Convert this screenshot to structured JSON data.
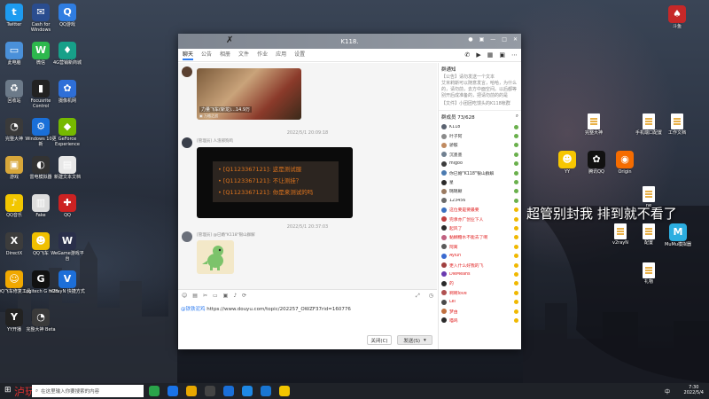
{
  "desktop": {
    "overlay_text": "超管别封我 排到就不看了",
    "icons_left": [
      {
        "label": "Twitter",
        "icon": "twitter-icon",
        "color": "#1d9bf0",
        "glyph": "t"
      },
      {
        "label": "Cash for Windows",
        "icon": "cash-icon",
        "color": "#2a4d8f",
        "glyph": "✉"
      },
      {
        "label": "QQ游戏",
        "icon": "qq-game-icon",
        "color": "#2f7de1",
        "glyph": "Q"
      },
      {
        "label": "此电脑",
        "icon": "computer-icon",
        "color": "#4a90d9",
        "glyph": "▭"
      },
      {
        "label": "微信",
        "icon": "wechat-icon",
        "color": "#2db84d",
        "glyph": "W"
      },
      {
        "label": "4G营销新商城",
        "icon": "mall-icon",
        "color": "#17a089",
        "glyph": "♦"
      },
      {
        "label": "回收站",
        "icon": "recycle-bin-icon",
        "color": "#6c7a89",
        "glyph": "♻"
      },
      {
        "label": "Focusrite Control",
        "icon": "focusrite-icon",
        "color": "#222",
        "glyph": "▮"
      },
      {
        "label": "摄像机网",
        "icon": "camera-net-icon",
        "color": "#2e6fd8",
        "glyph": "✿"
      },
      {
        "label": "完整大神",
        "icon": "speed-icon",
        "color": "#3a3a3a",
        "glyph": "◔"
      },
      {
        "label": "Windows 10更新",
        "icon": "update-icon",
        "color": "#1a6fd8",
        "glyph": "⚙"
      },
      {
        "label": "GeForce Experience",
        "icon": "geforce-icon",
        "color": "#76b900",
        "glyph": "◆"
      },
      {
        "label": "游戏",
        "icon": "game-folder-icon",
        "color": "#d8a73a",
        "glyph": "▣"
      },
      {
        "label": "雷电模拟器",
        "icon": "emulator-icon",
        "color": "#333",
        "glyph": "◐"
      },
      {
        "label": "新建文本文档",
        "icon": "text-doc-icon",
        "color": "#e8e8e8",
        "glyph": "▤"
      },
      {
        "label": "QQ音乐",
        "icon": "qq-music-icon",
        "color": "#f2c600",
        "glyph": "♪"
      },
      {
        "label": "Fake",
        "icon": "fake-icon",
        "color": "#ddd",
        "glyph": "▥"
      },
      {
        "label": "QQ",
        "icon": "qq-icon",
        "color": "#c22",
        "glyph": "✚"
      },
      {
        "label": "DirectX",
        "icon": "directx-icon",
        "color": "#3c3c3c",
        "glyph": "X"
      },
      {
        "label": "QQ飞车",
        "icon": "qq-speed-icon",
        "color": "#f0c000",
        "glyph": "☻"
      },
      {
        "label": "WeGame游戏平台",
        "icon": "wegame-icon",
        "color": "#2a2f4a",
        "glyph": "W"
      },
      {
        "label": "QQ飞车修复工具",
        "icon": "repair-icon",
        "color": "#f0a800",
        "glyph": "☺"
      },
      {
        "label": "Logitech G HUB",
        "icon": "logitech-icon",
        "color": "#111",
        "glyph": "G"
      },
      {
        "label": "v2rayN 快捷方式",
        "icon": "v2ray-icon",
        "color": "#1d6fd8",
        "glyph": "V"
      },
      {
        "label": "YY开播",
        "icon": "yy-icon",
        "color": "#222",
        "glyph": "Y"
      },
      {
        "label": "完整大神 Beta",
        "icon": "speed-beta-icon",
        "color": "#3a3a3a",
        "glyph": "◔"
      }
    ],
    "icons_right": [
      {
        "label": "斗鱼",
        "icon": "douyu-icon",
        "color": "#c62828",
        "glyph": "♠"
      },
      {
        "label": "完整大神",
        "icon": "file-icon"
      },
      {
        "label": "手机端口配置",
        "icon": "file-icon"
      },
      {
        "label": "工作文档",
        "icon": "file-icon"
      },
      {
        "label": "YY",
        "icon": "yy-face-icon",
        "color": "#f7c600",
        "glyph": "☻"
      },
      {
        "label": "腾讯QQ",
        "icon": "tencent-qq-icon",
        "color": "#111",
        "glyph": "✿"
      },
      {
        "label": "Origin",
        "icon": "origin-icon",
        "color": "#f56c00",
        "glyph": "◉"
      },
      {
        "label": "ne",
        "icon": "file-icon"
      },
      {
        "label": "v2rayN",
        "icon": "file-icon"
      },
      {
        "label": "配置",
        "icon": "file-icon"
      },
      {
        "label": "MuMu模拟器",
        "icon": "mumu-icon",
        "color": "#2caee0",
        "glyph": "M"
      },
      {
        "label": "礼物",
        "icon": "file-icon"
      }
    ]
  },
  "window": {
    "title": "K118.",
    "controls": [
      "●",
      "▣",
      "—",
      "□",
      "✕"
    ],
    "tabs": [
      "聊天",
      "公告",
      "相册",
      "文件",
      "作业",
      "应用",
      "设置"
    ],
    "active_tab": "聊天",
    "tool_icons": [
      "phone-icon",
      "video-icon",
      "screen-share-icon",
      "apps-icon",
      "more-icon"
    ],
    "tool_glyphs": [
      "✆",
      "▶",
      "▦",
      "▣",
      "⋯"
    ]
  },
  "chat": {
    "image_caption": "力量飞车(斩龙)…14.9万",
    "image_sub": "▣ 万格之战",
    "timestamp_1": "2022/5/1 20:09:18",
    "sender_2": "[管理员] 人渣邪狗鸡",
    "card_lines": [
      "• [Q1123367121]: 这是测试服",
      "• [Q1123367121]: 不让测挂？",
      "• [Q1123367121]: 你是来测试的吗"
    ],
    "timestamp_2": "2022/5/1 20:37:03",
    "sender_3": "[管理员] @已婚\"K118\"银山群解",
    "toolbar_icons": [
      "emoji-icon",
      "gif-icon",
      "scissors-icon",
      "folder-icon",
      "image-icon",
      "audio-icon",
      "history-icon"
    ],
    "toolbar_glyphs": [
      "☺",
      "▤",
      "✂",
      "▭",
      "▣",
      "♪",
      "⟳"
    ],
    "input_mention": "@铁铁泥鸡",
    "input_text": "https://www.douyu.com/topic/202257_OWZF37rid=160776",
    "close_label": "关闭(C)",
    "send_label": "发送(S)"
  },
  "sidebar": {
    "notice_title": "群通知",
    "notice_lines": [
      "【公告】请勿发送一个文本",
      "艾米莉斯可以随意发言，哈哈，为什么",
      "的，请勿前，去方中面空间。以后都等",
      "别开后成准备的，把请勿前的的是"
    ],
    "file_line": "【文件】小团团吃馒头的K118帐群",
    "members_title": "群成员 73/628",
    "members": [
      {
        "name": "K118",
        "color": "#5a6270",
        "red": false
      },
      {
        "name": "叶子阿",
        "color": "#8a8a8a",
        "red": false
      },
      {
        "name": "骄骸",
        "color": "#c08a60",
        "red": false
      },
      {
        "name": "沉墨墨",
        "color": "#708090",
        "red": false
      },
      {
        "name": "migoo",
        "color": "#3c3c3c",
        "red": false
      },
      {
        "name": "你已婚\"K118\"银山群解",
        "color": "#4a7ab0",
        "red": false
      },
      {
        "name": "星",
        "color": "#2a2a2a",
        "red": false
      },
      {
        "name": "璐璐颠",
        "color": "#9a7a60",
        "red": false
      },
      {
        "name": "123456",
        "color": "#6a6a6a",
        "red": false
      },
      {
        "name": "这位要是要最要",
        "color": "#3a70c0",
        "red": true
      },
      {
        "name": "完承亦广创业下人",
        "color": "#c04040",
        "red": true
      },
      {
        "name": "起风了",
        "color": "#2a2a2a",
        "red": true
      },
      {
        "name": "黏糊糖水不能去了啊",
        "color": "#c06080",
        "red": true
      },
      {
        "name": "阿离",
        "color": "#5a5a5a",
        "red": true
      },
      {
        "name": "Ayiun",
        "color": "#3a6ad0",
        "red": true
      },
      {
        "name": "更入什么好我的飞",
        "color": "#a04040",
        "red": true
      },
      {
        "name": "DieMeans",
        "color": "#6a3ab0",
        "red": true
      },
      {
        "name": "的",
        "color": "#2a2a2a",
        "red": true
      },
      {
        "name": "啊啊love",
        "color": "#b05050",
        "red": true
      },
      {
        "name": "Lei",
        "color": "#4a4a4a",
        "red": true
      },
      {
        "name": "梦由",
        "color": "#c07040",
        "red": true
      },
      {
        "name": "喵呜",
        "color": "#2a2a2a",
        "red": true
      }
    ]
  },
  "taskbar": {
    "brand": "泸玩",
    "search_placeholder": "在这里输入你要搜索的内容",
    "apps": [
      {
        "icon": "chrome-icon",
        "color": "#2aa44a"
      },
      {
        "icon": "edge-icon",
        "color": "#1a73e8"
      },
      {
        "icon": "file-explorer-icon",
        "color": "#e8a800"
      },
      {
        "icon": "obs-icon",
        "color": "#444"
      },
      {
        "icon": "store-icon",
        "color": "#1a6fd8"
      },
      {
        "icon": "qq-browser-icon",
        "color": "#1e88e5"
      },
      {
        "icon": "media-icon",
        "color": "#1976d2"
      },
      {
        "icon": "yy-task-icon",
        "color": "#f2c600"
      }
    ],
    "ime": "中",
    "time": "7:30",
    "date": "2022/5/4"
  }
}
